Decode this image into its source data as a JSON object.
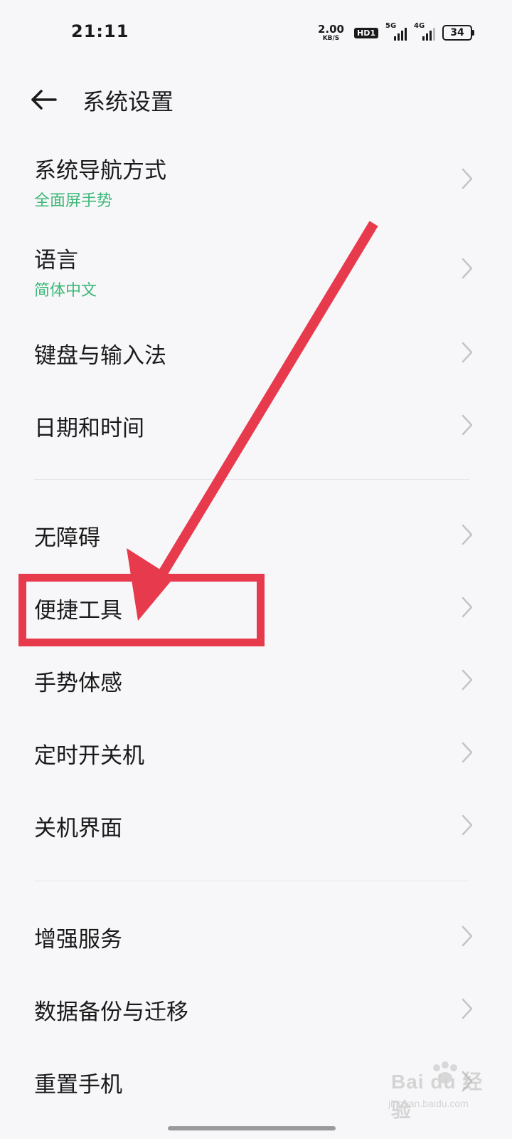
{
  "status_bar": {
    "time": "21:11",
    "net_speed_value": "2.00",
    "net_speed_unit": "KB/S",
    "hd_label": "HD1",
    "signal_1_label": "5G",
    "signal_2_label": "4G",
    "battery_level": "34"
  },
  "header": {
    "title": "系统设置",
    "back_icon": "arrow-left-icon"
  },
  "items": [
    {
      "label": "系统导航方式",
      "sub": "全面屏手势"
    },
    {
      "label": "语言",
      "sub": "简体中文"
    },
    {
      "label": "键盘与输入法",
      "sub": ""
    },
    {
      "label": "日期和时间",
      "sub": ""
    },
    {
      "label": "无障碍",
      "sub": ""
    },
    {
      "label": "便捷工具",
      "sub": ""
    },
    {
      "label": "手势体感",
      "sub": ""
    },
    {
      "label": "定时开关机",
      "sub": ""
    },
    {
      "label": "关机界面",
      "sub": ""
    },
    {
      "label": "增强服务",
      "sub": ""
    },
    {
      "label": "数据备份与迁移",
      "sub": ""
    },
    {
      "label": "重置手机",
      "sub": ""
    }
  ],
  "colors": {
    "accent_green": "#3cb878",
    "annotation_red": "#e83a4d",
    "background": "#f7f7f9"
  },
  "annotation": {
    "highlighted_item_index": 5
  },
  "watermark": {
    "brand": "Bai du 经验",
    "sub": "jingyan.baidu.com"
  }
}
